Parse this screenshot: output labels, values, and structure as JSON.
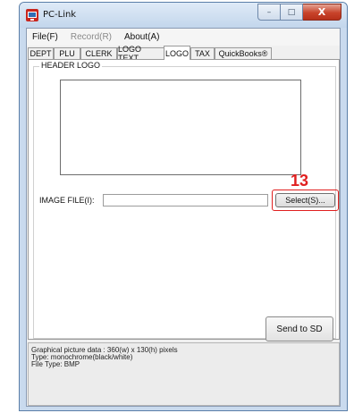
{
  "window": {
    "title": "PC-Link",
    "controls": {
      "minimize": "–",
      "maximize": "□",
      "close": "X"
    }
  },
  "menu": [
    {
      "label": "File(F)",
      "disabled": false
    },
    {
      "label": "Record(R)",
      "disabled": true
    },
    {
      "label": "About(A)",
      "disabled": false
    }
  ],
  "tabs": [
    {
      "label": "DEPT",
      "active": false
    },
    {
      "label": "PLU",
      "active": false
    },
    {
      "label": "CLERK",
      "active": false
    },
    {
      "label": "LOGO TEXT",
      "active": false
    },
    {
      "label": "LOGO",
      "active": true
    },
    {
      "label": "TAX",
      "active": false
    },
    {
      "label": "QuickBooks®",
      "active": false
    }
  ],
  "logo_panel": {
    "group_label": "HEADER LOGO",
    "file_label": "IMAGE FILE(I):",
    "file_value": "",
    "select_button": "Select(S)...",
    "send_button": "Send to SD"
  },
  "callout": {
    "number": "13",
    "color": "#e01f1f"
  },
  "info": {
    "lines": [
      "Graphical picture data : 360(w) x 130(h) pixels",
      "Type: monochrome(black/white)",
      "File Type: BMP"
    ]
  },
  "icons": {
    "app": "app-icon",
    "minimize": "minimize-icon",
    "maximize": "maximize-icon",
    "close": "close-icon"
  }
}
